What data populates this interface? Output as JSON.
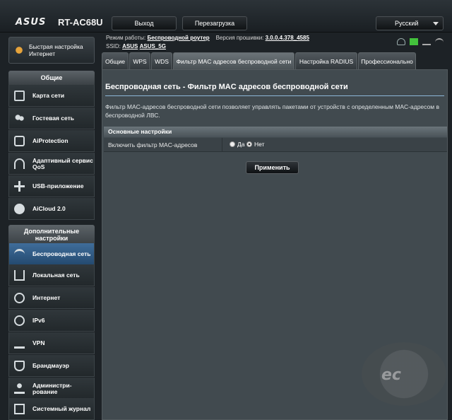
{
  "header": {
    "brand": "ASUS",
    "model": "RT-AC68U",
    "logout_label": "Выход",
    "reboot_label": "Перезагрузка",
    "language": "Русский"
  },
  "info": {
    "mode_label": "Режим работы:",
    "mode_value": "Беспроводной роутер",
    "firmware_label": "Версия прошивки:",
    "firmware_value": "3.0.0.4.378_4585",
    "ssid_label": "SSID:",
    "ssid_1": "ASUS",
    "ssid_2": "ASUS_5G"
  },
  "sidebar": {
    "quick_setup": "Быстрая настройка Интернет",
    "general_title": "Общие",
    "general_items": [
      {
        "label": "Карта сети",
        "icon": "network-map-icon"
      },
      {
        "label": "Гостевая сеть",
        "icon": "guest-network-icon"
      },
      {
        "label": "AiProtection",
        "icon": "lock-icon"
      },
      {
        "label": "Адаптивный сервис QoS",
        "icon": "speedometer-icon"
      },
      {
        "label": "USB-приложение",
        "icon": "puzzle-icon"
      },
      {
        "label": "AiCloud 2.0",
        "icon": "cloud-icon"
      }
    ],
    "advanced_title": "Дополнительные настройки",
    "advanced_items": [
      {
        "label": "Беспроводная сеть",
        "icon": "wifi-icon"
      },
      {
        "label": "Локальная сеть",
        "icon": "home-icon"
      },
      {
        "label": "Интернет",
        "icon": "globe-icon"
      },
      {
        "label": "IPv6",
        "icon": "ipv6-icon"
      },
      {
        "label": "VPN",
        "icon": "vpn-icon"
      },
      {
        "label": "Брандмауэр",
        "icon": "firewall-icon"
      },
      {
        "label": "Администри-рование",
        "icon": "admin-icon"
      },
      {
        "label": "Системный журнал",
        "icon": "log-icon"
      }
    ]
  },
  "tabs": [
    "Общие",
    "WPS",
    "WDS",
    "Фильтр MAC адресов беспроводной сети",
    "Настройка RADIUS",
    "Профессионально"
  ],
  "main": {
    "title": "Беспроводная сеть - Фильтр MAC адресов беспроводной сети",
    "description": "Фильтр MAC-адресов беспроводной сети позволяет управлять пакетами от устройств с определенным MAC-адресом в беспроводной ЛВС.",
    "section_title": "Основные настройки",
    "field_label": "Включить фильтр MAC-адресов",
    "option_yes": "Да",
    "option_no": "Нет",
    "selected": "Нет",
    "apply_label": "Применить"
  },
  "watermark": "ec"
}
